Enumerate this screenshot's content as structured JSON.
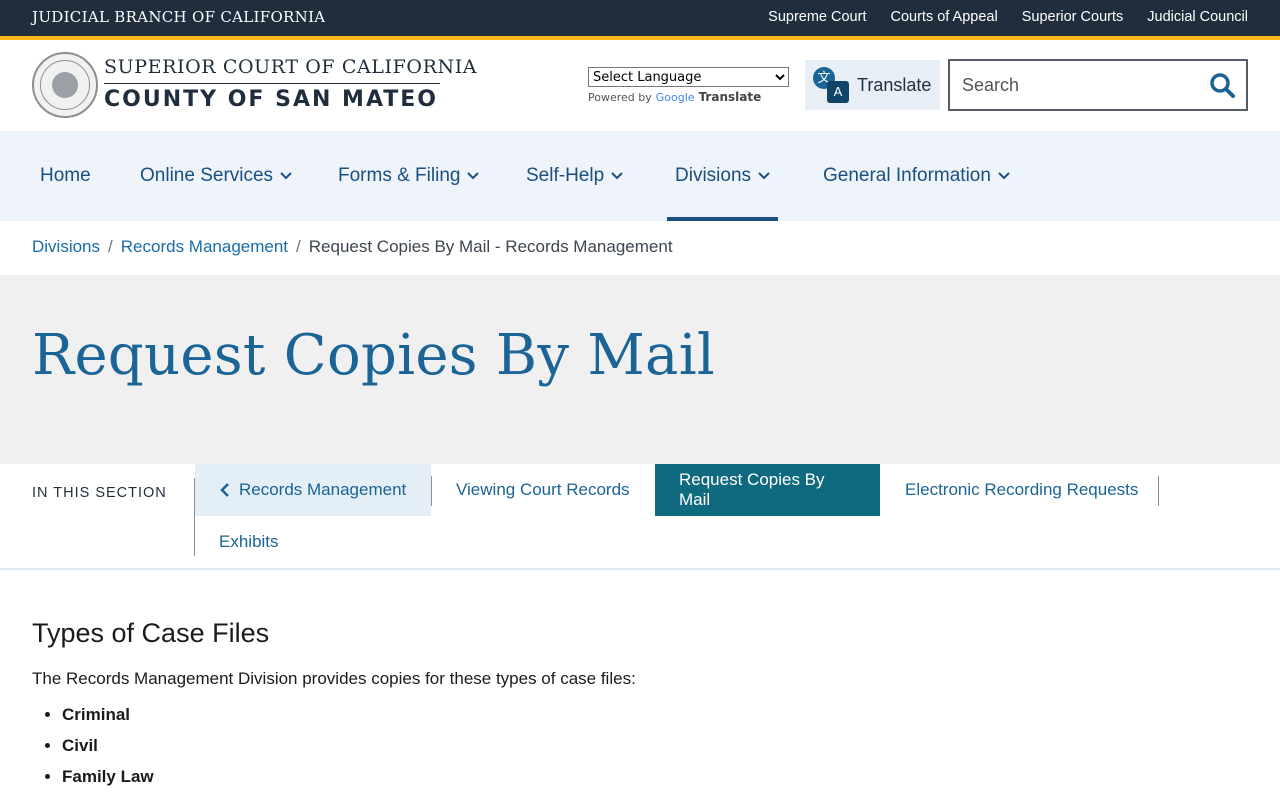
{
  "topbar": {
    "brand": "JUDICIAL BRANCH OF CALIFORNIA",
    "links": [
      "Supreme Court",
      "Courts of Appeal",
      "Superior Courts",
      "Judicial Council"
    ]
  },
  "header": {
    "seal_text": "JUDICIAL BRANCH OF CALIFORNIA",
    "site_name_line1": "SUPERIOR COURT OF CALIFORNIA",
    "site_name_line2": "COUNTY OF SAN MATEO",
    "language_select": {
      "selected": "Select Language"
    },
    "powered_by": "Powered by",
    "google": "Google",
    "translate_word": "Translate",
    "translate_button": "Translate",
    "search_placeholder": "Search"
  },
  "nav": {
    "items": [
      {
        "label": "Home",
        "has_dropdown": false
      },
      {
        "label": "Online Services",
        "has_dropdown": true
      },
      {
        "label": "Forms & Filing",
        "has_dropdown": true
      },
      {
        "label": "Self-Help",
        "has_dropdown": true
      },
      {
        "label": "Divisions",
        "has_dropdown": true,
        "active": true
      },
      {
        "label": "General Information",
        "has_dropdown": true
      }
    ]
  },
  "breadcrumb": {
    "items": [
      "Divisions",
      "Records Management"
    ],
    "separator": "/",
    "current": "Request Copies By Mail - Records Management"
  },
  "page": {
    "title": "Request Copies By Mail"
  },
  "section_nav": {
    "label": "IN THIS SECTION",
    "back": "Records Management",
    "items": [
      "Viewing Court Records",
      "Request Copies By Mail",
      "Electronic Recording Requests",
      "Exhibits"
    ],
    "active": "Request Copies By Mail"
  },
  "content": {
    "heading": "Types of Case Files",
    "intro": "The Records Management Division provides copies for these types of case files:",
    "list": [
      "Criminal",
      "Civil",
      "Family Law"
    ]
  },
  "colors": {
    "topbar": "#1f2d3d",
    "gold": "#fdb81e",
    "link": "#1a6496",
    "active_tab": "#0f6a80",
    "nav_bg": "#eef4fa",
    "hero_bg": "#f0f0f0"
  }
}
